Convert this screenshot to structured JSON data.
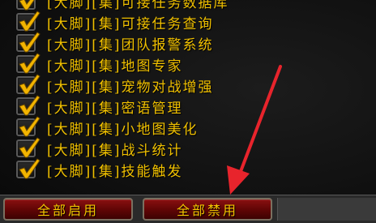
{
  "addons": [
    {
      "label": "[大脚][集]可接任务数据库",
      "checked": true
    },
    {
      "label": "[大脚][集]可接任务查询",
      "checked": true
    },
    {
      "label": "[大脚][集]团队报警系统",
      "checked": true
    },
    {
      "label": "[大脚][集]地图专家",
      "checked": true
    },
    {
      "label": "[大脚][集]宠物对战增强",
      "checked": true
    },
    {
      "label": "[大脚][集]密语管理",
      "checked": true
    },
    {
      "label": "[大脚][集]小地图美化",
      "checked": true
    },
    {
      "label": "[大脚][集]战斗统计",
      "checked": true
    },
    {
      "label": "[大脚][集]技能触发",
      "checked": true
    }
  ],
  "buttons": {
    "enable_all": "全部启用",
    "disable_all": "全部禁用"
  },
  "colors": {
    "label": "#f0c000",
    "check": "#f2b400",
    "button_bg": "#7a0a0a",
    "arrow": "#e8242c"
  },
  "icons": {
    "check": "check-icon",
    "annotation": "red-arrow-icon"
  }
}
